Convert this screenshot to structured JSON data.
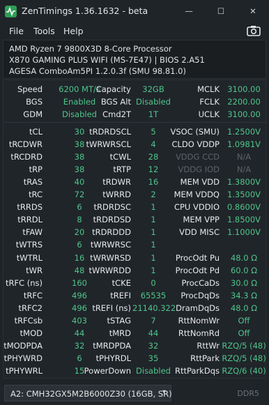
{
  "window": {
    "title": "ZenTimings 1.36.1632 - beta",
    "minimize": "—",
    "maximize": "☐",
    "close": "✕"
  },
  "menu": {
    "file": "File",
    "tools": "Tools",
    "help": "Help"
  },
  "info": {
    "cpu": "AMD Ryzen 7 9800X3D 8-Core Processor",
    "board": "X870 GAMING PLUS WIFI (MS-7E47) | BIOS 2.A51",
    "agesa": "AGESA ComboAm5PI 1.2.0.3f (SMU 98.81.0)"
  },
  "rows": [
    [
      [
        "Speed",
        "6200 MT/s"
      ],
      [
        "Capacity",
        "32GB"
      ],
      [
        "MCLK",
        "3100.00"
      ]
    ],
    [
      [
        "BGS",
        "Enabled"
      ],
      [
        "BGS Alt",
        "Disabled"
      ],
      [
        "FCLK",
        "2200.00"
      ]
    ],
    [
      [
        "GDM",
        "Disabled"
      ],
      [
        "Cmd2T",
        "1T"
      ],
      [
        "UCLK",
        "3100.00"
      ]
    ],
    [
      [
        "tCL",
        "30"
      ],
      [
        "tRDRDSCL",
        "5"
      ],
      [
        "VSOC (SMU)",
        "1.2500V"
      ]
    ],
    [
      [
        "tRCDWR",
        "38"
      ],
      [
        "tWRWRSCL",
        "4"
      ],
      [
        "CLDO VDDP",
        "1.0981V"
      ]
    ],
    [
      [
        "tRCDRD",
        "38"
      ],
      [
        "tCWL",
        "28"
      ],
      [
        "VDDG CCD",
        "N/A"
      ]
    ],
    [
      [
        "tRP",
        "38"
      ],
      [
        "tRTP",
        "12"
      ],
      [
        "VDDG IOD",
        "N/A"
      ]
    ],
    [
      [
        "tRAS",
        "40"
      ],
      [
        "tRDWR",
        "16"
      ],
      [
        "MEM VDD",
        "1.3800V"
      ]
    ],
    [
      [
        "tRC",
        "72"
      ],
      [
        "tWRRD",
        "2"
      ],
      [
        "MEM VDDQ",
        "1.3500V"
      ]
    ],
    [
      [
        "tRRDS",
        "6"
      ],
      [
        "tRDRDSC",
        "1"
      ],
      [
        "CPU VDDIO",
        "0.8600V"
      ]
    ],
    [
      [
        "tRRDL",
        "8"
      ],
      [
        "tRDRDSD",
        "1"
      ],
      [
        "MEM VPP",
        "1.8500V"
      ]
    ],
    [
      [
        "tFAW",
        "20"
      ],
      [
        "tRDRDDD",
        "1"
      ],
      [
        "VDD MISC",
        "1.1000V"
      ]
    ],
    [
      [
        "tWTRS",
        "6"
      ],
      [
        "tWRWRSC",
        "1"
      ],
      [
        "",
        ""
      ]
    ],
    [
      [
        "tWTRL",
        "16"
      ],
      [
        "tWRWRSD",
        "1"
      ],
      [
        "ProcOdt Pu",
        "48.0 Ω"
      ]
    ],
    [
      [
        "tWR",
        "48"
      ],
      [
        "tWRWRDD",
        "1"
      ],
      [
        "ProcOdt Pd",
        "60.0 Ω"
      ]
    ],
    [
      [
        "tRFC (ns)",
        "160"
      ],
      [
        "tCKE",
        "0"
      ],
      [
        "ProcCaDs",
        "30.0 Ω"
      ]
    ],
    [
      [
        "tRFC",
        "496"
      ],
      [
        "tREFI",
        "65535"
      ],
      [
        "ProcDqDs",
        "34.3 Ω"
      ]
    ],
    [
      [
        "tRFC2",
        "496"
      ],
      [
        "tREFI (ns)",
        "21140.322"
      ],
      [
        "DramDqDs",
        "48.0 Ω"
      ]
    ],
    [
      [
        "tRFCsb",
        "403"
      ],
      [
        "tSTAG",
        "7"
      ],
      [
        "RttNomWr",
        "Off"
      ]
    ],
    [
      [
        "tMOD",
        "44"
      ],
      [
        "tMRD",
        "44"
      ],
      [
        "RttNomRd",
        "Off"
      ]
    ],
    [
      [
        "tMODPDA",
        "32"
      ],
      [
        "tMRDPDA",
        "32"
      ],
      [
        "RttWr",
        "RZQ/5 (48)"
      ]
    ],
    [
      [
        "tPHYWRD",
        "6"
      ],
      [
        "tPHYRDL",
        "35"
      ],
      [
        "RttPark",
        "RZQ/5 (48)"
      ]
    ],
    [
      [
        "tPHYWRL",
        "15"
      ],
      [
        "PowerDown",
        "Disabled"
      ],
      [
        "RttParkDqs",
        "RZQ/6 (40)"
      ]
    ]
  ],
  "dim_rows": [
    5,
    6
  ],
  "footer": {
    "module": "A2: CMH32GX5M2B6000Z30 (16GB, SR)",
    "arrow": "▾",
    "type": "DDR5"
  },
  "colors": {
    "value": "#4fc58a",
    "label": "#e8eaec",
    "dim": "#5b6268",
    "background": "#1f2428"
  }
}
